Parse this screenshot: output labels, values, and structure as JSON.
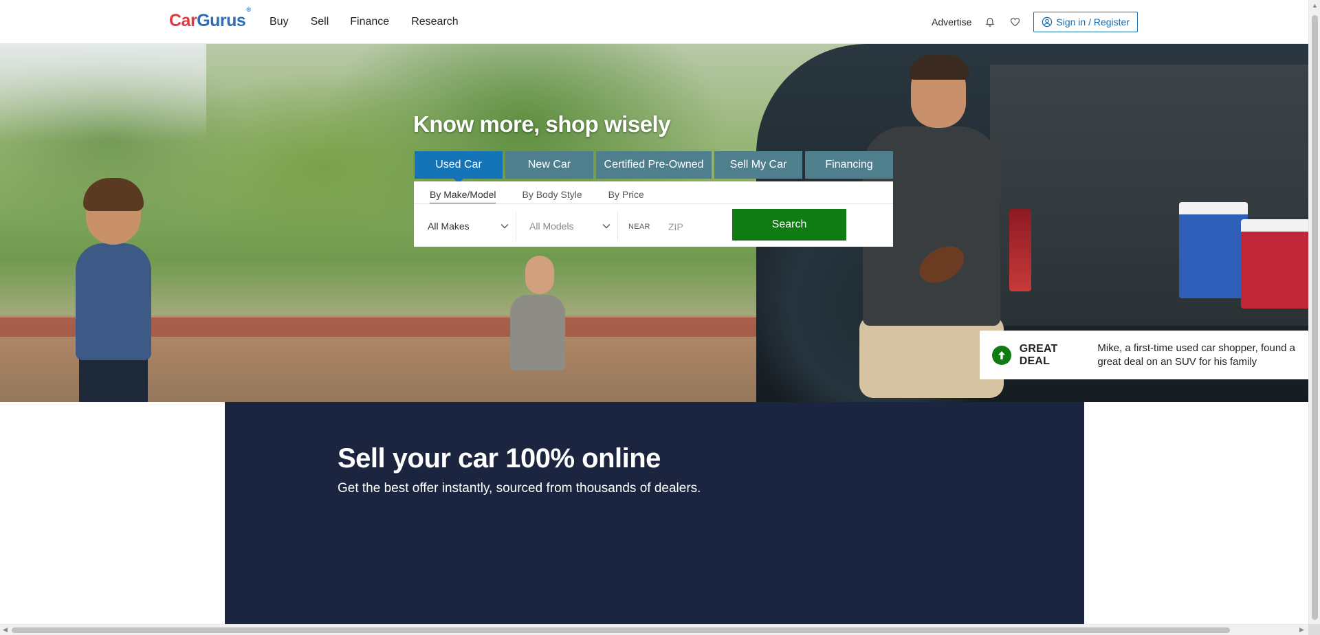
{
  "logo": {
    "car": "Car",
    "gurus": "Gurus",
    "mark": "®"
  },
  "nav": {
    "items": [
      "Buy",
      "Sell",
      "Finance",
      "Research"
    ]
  },
  "header_right": {
    "advertise": "Advertise",
    "signin": "Sign in / Register",
    "icons": [
      "bell-icon",
      "heart-icon",
      "user-circle-icon"
    ]
  },
  "hero": {
    "title": "Know more, shop wisely",
    "tabs": [
      "Used Car",
      "New Car",
      "Certified Pre-Owned",
      "Sell My Car",
      "Financing"
    ],
    "active_tab": "Used Car",
    "subtabs": [
      "By Make/Model",
      "By Body Style",
      "By Price"
    ],
    "active_subtab": "By Make/Model",
    "make_value": "All Makes",
    "model_value": "All Models",
    "near_label": "NEAR",
    "zip_placeholder": "ZIP",
    "search_label": "Search",
    "deal": {
      "label": "GREAT DEAL",
      "text": "Mike, a first-time used car shopper, found a great deal on an SUV for his family"
    }
  },
  "sell_section": {
    "title": "Sell your car 100% online",
    "subtitle": "Get the best offer instantly, sourced from thousands of dealers."
  },
  "colors": {
    "brand_blue": "#1573b8",
    "tab_inactive": "#4f7f8d",
    "search_green": "#0f7b12",
    "sell_bg": "#1b2540",
    "logo_red": "#e0383e"
  }
}
